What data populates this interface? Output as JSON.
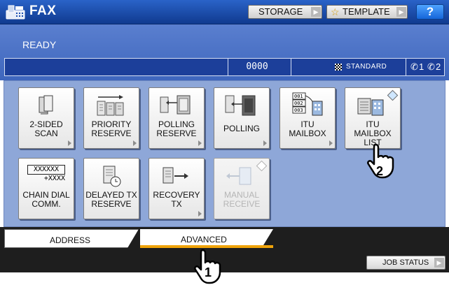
{
  "header": {
    "title": "FAX",
    "storage_label": "STORAGE",
    "template_label": "TEMPLATE",
    "help_label": "?"
  },
  "status": {
    "text": "READY",
    "counter": "0000",
    "resolution": "STANDARD",
    "line1": "1",
    "line2": "2"
  },
  "functions": [
    {
      "label": "2-SIDED\nSCAN",
      "icon": "two-sided-scan-icon",
      "enabled": true
    },
    {
      "label": "PRIORITY\nRESERVE",
      "icon": "priority-reserve-icon",
      "enabled": true
    },
    {
      "label": "POLLING\nRESERVE",
      "icon": "polling-reserve-icon",
      "enabled": true
    },
    {
      "label": "POLLING",
      "icon": "polling-icon",
      "enabled": true
    },
    {
      "label": "ITU\nMAILBOX",
      "icon": "itu-mailbox-icon",
      "enabled": true
    },
    {
      "label": "ITU\nMAILBOX LIST",
      "icon": "itu-mailbox-list-icon",
      "enabled": true
    },
    {
      "label": "CHAIN DIAL\nCOMM.",
      "icon": "chain-dial-icon",
      "enabled": true,
      "icon_text_top": "XXXXXX",
      "icon_text_bottom": "+XXXX"
    },
    {
      "label": "DELAYED TX\nRESERVE",
      "icon": "delayed-tx-icon",
      "enabled": true
    },
    {
      "label": "RECOVERY\nTX",
      "icon": "recovery-tx-icon",
      "enabled": true
    },
    {
      "label": "MANUAL\nRECEIVE",
      "icon": "manual-receive-icon",
      "enabled": false
    }
  ],
  "tabs": {
    "address": "ADDRESS",
    "advanced": "ADVANCED",
    "active": "advanced"
  },
  "footer": {
    "job_status": "JOB STATUS"
  },
  "callouts": {
    "step1": "1",
    "step2": "2"
  },
  "colors": {
    "header_blue": "#1c4fb0",
    "panel_blue": "#8ea7d8",
    "active_tab_underline": "#f0a30a",
    "help_blue": "#1e78f0"
  }
}
